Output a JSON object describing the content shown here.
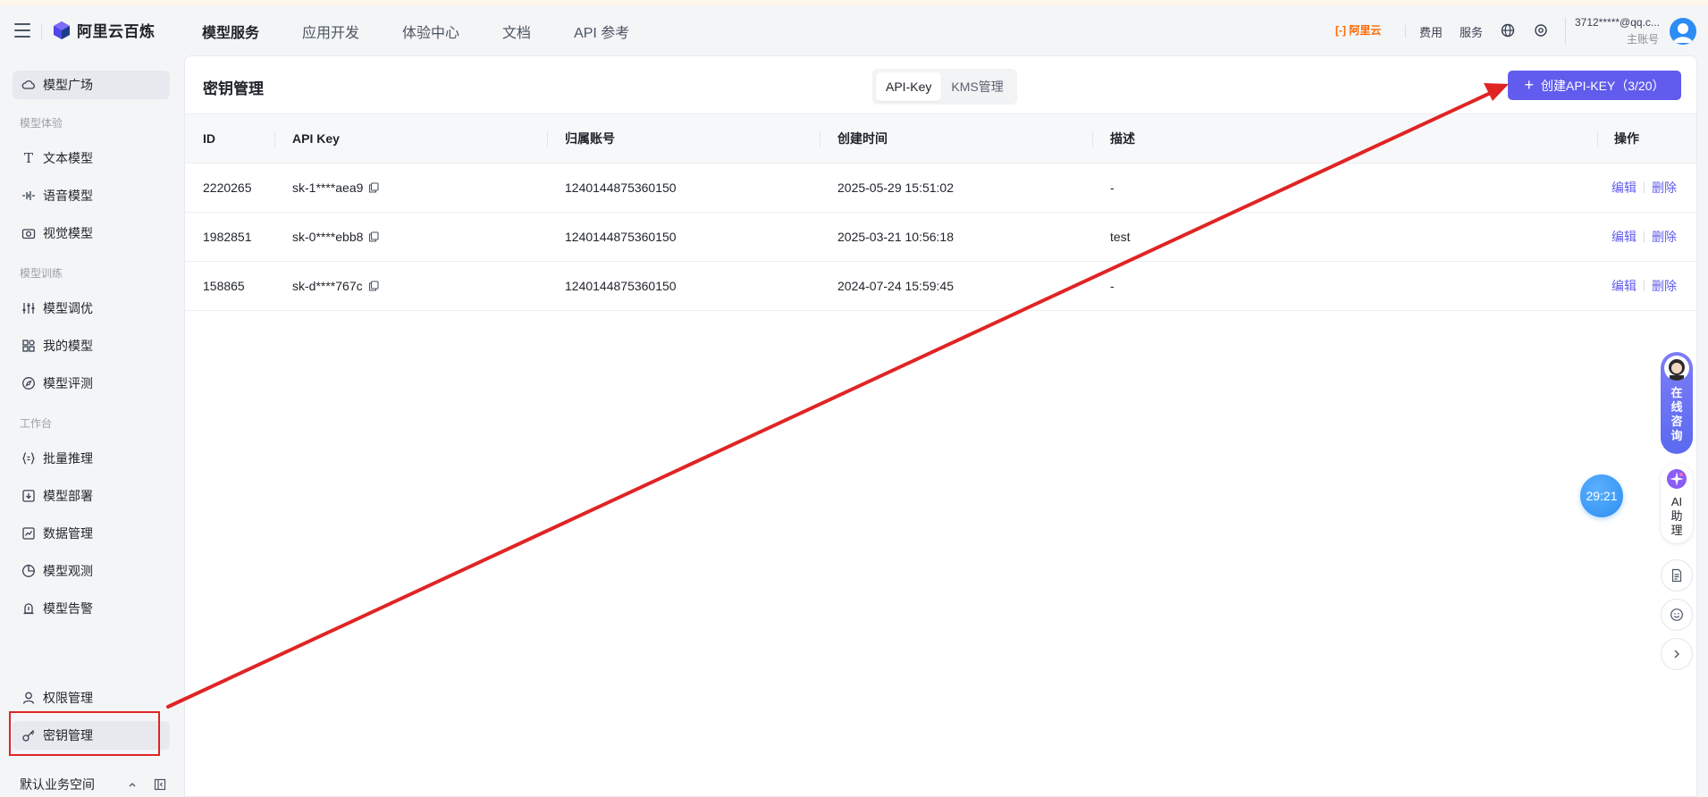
{
  "header": {
    "logo_text": "阿里云百炼",
    "nav": [
      "模型服务",
      "应用开发",
      "体验中心",
      "文档",
      "API 参考"
    ],
    "aliyun_logo": "阿里云",
    "links": {
      "billing": "费用",
      "service": "服务"
    },
    "account": {
      "email": "3712*****@qq.c...",
      "role": "主账号"
    }
  },
  "sidebar": {
    "top_item": "模型广场",
    "group1": "模型体验",
    "exp_items": [
      "文本模型",
      "语音模型",
      "视觉模型"
    ],
    "group2": "模型训练",
    "train_items": [
      "模型调优",
      "我的模型",
      "模型评测"
    ],
    "group3": "工作台",
    "work_items": [
      "批量推理",
      "模型部署",
      "数据管理",
      "模型观测",
      "模型告警"
    ],
    "perm_item": "权限管理",
    "key_item": "密钥管理",
    "workspace": "默认业务空间"
  },
  "main": {
    "title": "密钥管理",
    "tabs": [
      "API-Key",
      "KMS管理"
    ],
    "create_button": "创建API-KEY（3/20）",
    "columns": [
      "ID",
      "API Key",
      "归属账号",
      "创建时间",
      "描述",
      "操作"
    ],
    "rows": [
      {
        "id": "2220265",
        "key": "sk-1****aea9",
        "account": "1240144875360150",
        "created": "2025-05-29 15:51:02",
        "desc": "-"
      },
      {
        "id": "1982851",
        "key": "sk-0****ebb8",
        "account": "1240144875360150",
        "created": "2025-03-21 10:56:18",
        "desc": "test"
      },
      {
        "id": "158865",
        "key": "sk-d****767c",
        "account": "1240144875360150",
        "created": "2024-07-24 15:59:45",
        "desc": "-"
      }
    ],
    "ops": {
      "edit": "编辑",
      "delete": "删除"
    }
  },
  "floating": {
    "consult": "在线咨询",
    "ai_helper": "AI助理",
    "timer": "29:21"
  },
  "colors": {
    "accent": "#615ced",
    "annotation": "#e02424"
  }
}
